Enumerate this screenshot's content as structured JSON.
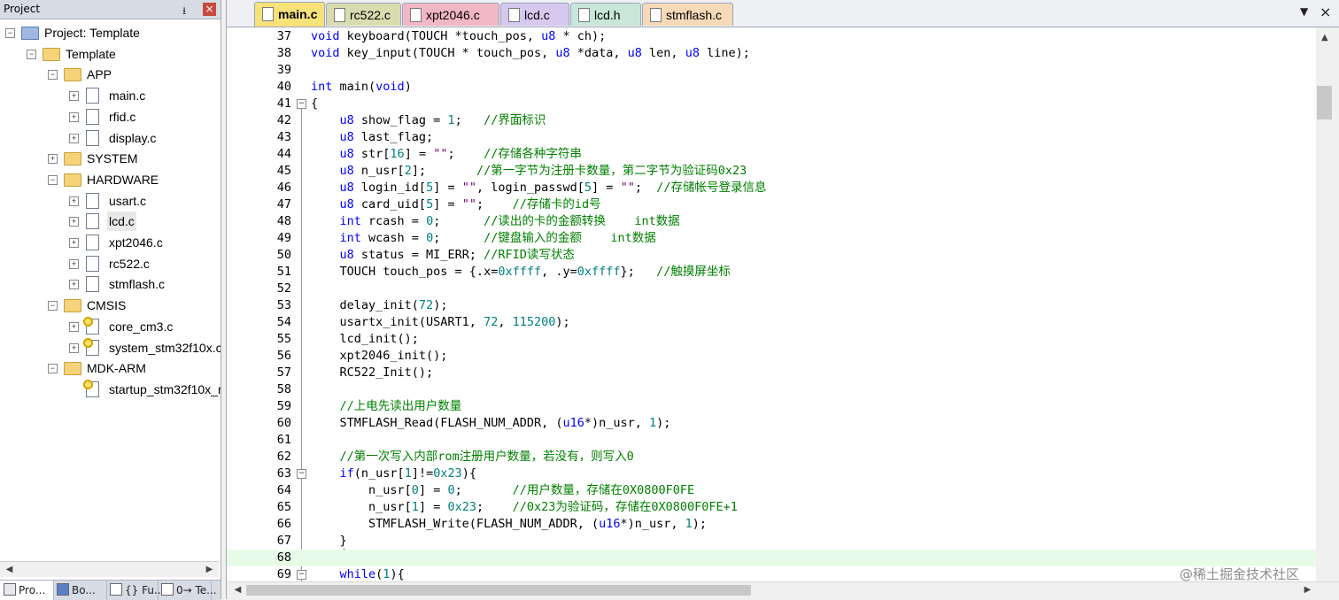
{
  "project_panel": {
    "title": "Project",
    "pin": "⭳",
    "close": "×",
    "tree": [
      {
        "label": "Project: Template",
        "kind": "project",
        "level": 0,
        "expander": "−"
      },
      {
        "label": "Template",
        "kind": "target",
        "level": 1,
        "expander": "−"
      },
      {
        "label": "APP",
        "kind": "folder",
        "level": 2,
        "expander": "−"
      },
      {
        "label": "main.c",
        "kind": "file",
        "level": 3,
        "expander": "+"
      },
      {
        "label": "rfid.c",
        "kind": "file",
        "level": 3,
        "expander": "+"
      },
      {
        "label": "display.c",
        "kind": "file",
        "level": 3,
        "expander": "+"
      },
      {
        "label": "SYSTEM",
        "kind": "folder",
        "level": 2,
        "expander": "+"
      },
      {
        "label": "HARDWARE",
        "kind": "folder",
        "level": 2,
        "expander": "−"
      },
      {
        "label": "usart.c",
        "kind": "file",
        "level": 3,
        "expander": "+"
      },
      {
        "label": "lcd.c",
        "kind": "file",
        "level": 3,
        "expander": "+",
        "selected": true
      },
      {
        "label": "xpt2046.c",
        "kind": "file",
        "level": 3,
        "expander": "+"
      },
      {
        "label": "rc522.c",
        "kind": "file",
        "level": 3,
        "expander": "+"
      },
      {
        "label": "stmflash.c",
        "kind": "file",
        "level": 3,
        "expander": "+"
      },
      {
        "label": "CMSIS",
        "kind": "folder",
        "level": 2,
        "expander": "−"
      },
      {
        "label": "core_cm3.c",
        "kind": "keyfile",
        "level": 3,
        "expander": "+"
      },
      {
        "label": "system_stm32f10x.c",
        "kind": "keyfile",
        "level": 3,
        "expander": "+"
      },
      {
        "label": "MDK-ARM",
        "kind": "folder",
        "level": 2,
        "expander": "−"
      },
      {
        "label": "startup_stm32f10x_md.s",
        "kind": "keyfile",
        "level": 3,
        "expander": ""
      }
    ],
    "bottom_tabs": [
      {
        "label": "Pro...",
        "icon": "project-tab-icon",
        "active": true
      },
      {
        "label": "Bo...",
        "icon": "books-tab-icon"
      },
      {
        "label": "{} Fu...",
        "icon": "functions-tab-icon"
      },
      {
        "label": "0→ Te...",
        "icon": "templates-tab-icon"
      }
    ]
  },
  "editor": {
    "tabs": [
      {
        "label": "main.c",
        "color": "#f7e27a",
        "active": true
      },
      {
        "label": "rc522.c",
        "color": "#d8ddb0"
      },
      {
        "label": "xpt2046.c",
        "color": "#f2b7c4"
      },
      {
        "label": "lcd.c",
        "color": "#d6c8ef"
      },
      {
        "label": "lcd.h",
        "color": "#c8e6d9"
      },
      {
        "label": "stmflash.c",
        "color": "#f6d9b8"
      }
    ],
    "dropdown": "▼",
    "close": "×",
    "current_line": 68,
    "lines": [
      {
        "n": "37",
        "fold": "",
        "tokens": [
          [
            "kw",
            "void"
          ],
          [
            "tx",
            " keyboard(TOUCH *touch_pos, "
          ],
          [
            "kw",
            "u8"
          ],
          [
            "tx",
            " * ch);"
          ]
        ]
      },
      {
        "n": "38",
        "fold": "",
        "tokens": [
          [
            "kw",
            "void"
          ],
          [
            "tx",
            " key_input(TOUCH * touch_pos, "
          ],
          [
            "kw",
            "u8"
          ],
          [
            "tx",
            " *data, "
          ],
          [
            "kw",
            "u8"
          ],
          [
            "tx",
            " len, "
          ],
          [
            "kw",
            "u8"
          ],
          [
            "tx",
            " line);"
          ]
        ]
      },
      {
        "n": "39",
        "fold": "",
        "tokens": []
      },
      {
        "n": "40",
        "fold": "",
        "tokens": [
          [
            "kw",
            "int"
          ],
          [
            "tx",
            " main("
          ],
          [
            "kw",
            "void"
          ],
          [
            "tx",
            ")"
          ]
        ]
      },
      {
        "n": "41",
        "fold": "box",
        "tokens": [
          [
            "tx",
            "{"
          ]
        ]
      },
      {
        "n": "42",
        "fold": "",
        "tokens": [
          [
            "tx",
            "    "
          ],
          [
            "kw",
            "u8"
          ],
          [
            "tx",
            " show_flag = "
          ],
          [
            "num",
            "1"
          ],
          [
            "tx",
            ";   "
          ],
          [
            "cm",
            "//界面标识"
          ]
        ]
      },
      {
        "n": "43",
        "fold": "",
        "tokens": [
          [
            "tx",
            "    "
          ],
          [
            "kw",
            "u8"
          ],
          [
            "tx",
            " last_flag;"
          ]
        ]
      },
      {
        "n": "44",
        "fold": "",
        "tokens": [
          [
            "tx",
            "    "
          ],
          [
            "kw",
            "u8"
          ],
          [
            "tx",
            " str["
          ],
          [
            "num",
            "16"
          ],
          [
            "tx",
            "] = "
          ],
          [
            "str",
            "\"\""
          ],
          [
            "tx",
            ";    "
          ],
          [
            "cm",
            "//存储各种字符串"
          ]
        ]
      },
      {
        "n": "45",
        "fold": "",
        "tokens": [
          [
            "tx",
            "    "
          ],
          [
            "kw",
            "u8"
          ],
          [
            "tx",
            " n_usr["
          ],
          [
            "num",
            "2"
          ],
          [
            "tx",
            "];       "
          ],
          [
            "cm",
            "//第一字节为注册卡数量，第二字节为验证码0x23"
          ]
        ]
      },
      {
        "n": "46",
        "fold": "",
        "tokens": [
          [
            "tx",
            "    "
          ],
          [
            "kw",
            "u8"
          ],
          [
            "tx",
            " login_id["
          ],
          [
            "num",
            "5"
          ],
          [
            "tx",
            "] = "
          ],
          [
            "str",
            "\"\""
          ],
          [
            "tx",
            ", login_passwd["
          ],
          [
            "num",
            "5"
          ],
          [
            "tx",
            "] = "
          ],
          [
            "str",
            "\"\""
          ],
          [
            "tx",
            ";  "
          ],
          [
            "cm",
            "//存储帐号登录信息"
          ]
        ]
      },
      {
        "n": "47",
        "fold": "",
        "tokens": [
          [
            "tx",
            "    "
          ],
          [
            "kw",
            "u8"
          ],
          [
            "tx",
            " card_uid["
          ],
          [
            "num",
            "5"
          ],
          [
            "tx",
            "] = "
          ],
          [
            "str",
            "\"\""
          ],
          [
            "tx",
            ";    "
          ],
          [
            "cm",
            "//存储卡的id号"
          ]
        ]
      },
      {
        "n": "48",
        "fold": "",
        "tokens": [
          [
            "tx",
            "    "
          ],
          [
            "kw",
            "int"
          ],
          [
            "tx",
            " rcash = "
          ],
          [
            "num",
            "0"
          ],
          [
            "tx",
            ";      "
          ],
          [
            "cm",
            "//读出的卡的金额转换    int数据"
          ]
        ]
      },
      {
        "n": "49",
        "fold": "",
        "tokens": [
          [
            "tx",
            "    "
          ],
          [
            "kw",
            "int"
          ],
          [
            "tx",
            " wcash = "
          ],
          [
            "num",
            "0"
          ],
          [
            "tx",
            ";      "
          ],
          [
            "cm",
            "//键盘输入的金额    int数据"
          ]
        ]
      },
      {
        "n": "50",
        "fold": "",
        "tokens": [
          [
            "tx",
            "    "
          ],
          [
            "kw",
            "u8"
          ],
          [
            "tx",
            " status = MI_ERR; "
          ],
          [
            "cm",
            "//RFID读写状态"
          ]
        ]
      },
      {
        "n": "51",
        "fold": "",
        "tokens": [
          [
            "tx",
            "    TOUCH touch_pos = {.x="
          ],
          [
            "num",
            "0xffff"
          ],
          [
            "tx",
            ", .y="
          ],
          [
            "num",
            "0xffff"
          ],
          [
            "tx",
            "};   "
          ],
          [
            "cm",
            "//触摸屏坐标"
          ]
        ]
      },
      {
        "n": "52",
        "fold": "",
        "tokens": []
      },
      {
        "n": "53",
        "fold": "",
        "tokens": [
          [
            "tx",
            "    delay_init("
          ],
          [
            "num",
            "72"
          ],
          [
            "tx",
            ");"
          ]
        ]
      },
      {
        "n": "54",
        "fold": "",
        "tokens": [
          [
            "tx",
            "    usartx_init(USART1, "
          ],
          [
            "num",
            "72"
          ],
          [
            "tx",
            ", "
          ],
          [
            "num",
            "115200"
          ],
          [
            "tx",
            ");"
          ]
        ]
      },
      {
        "n": "55",
        "fold": "",
        "tokens": [
          [
            "tx",
            "    lcd_init();"
          ]
        ]
      },
      {
        "n": "56",
        "fold": "",
        "tokens": [
          [
            "tx",
            "    xpt2046_init();"
          ]
        ]
      },
      {
        "n": "57",
        "fold": "",
        "tokens": [
          [
            "tx",
            "    RC522_Init();"
          ]
        ]
      },
      {
        "n": "58",
        "fold": "",
        "tokens": []
      },
      {
        "n": "59",
        "fold": "",
        "tokens": [
          [
            "tx",
            "    "
          ],
          [
            "cm",
            "//上电先读出用户数量"
          ]
        ]
      },
      {
        "n": "60",
        "fold": "",
        "tokens": [
          [
            "tx",
            "    STMFLASH_Read(FLASH_NUM_ADDR, ("
          ],
          [
            "kw",
            "u16"
          ],
          [
            "tx",
            "*)n_usr, "
          ],
          [
            "num",
            "1"
          ],
          [
            "tx",
            ");"
          ]
        ]
      },
      {
        "n": "61",
        "fold": "",
        "tokens": []
      },
      {
        "n": "62",
        "fold": "",
        "tokens": [
          [
            "tx",
            "    "
          ],
          [
            "cm",
            "//第一次写入内部rom注册用户数量，若没有，则写入0"
          ]
        ]
      },
      {
        "n": "63",
        "fold": "box",
        "tokens": [
          [
            "tx",
            "    "
          ],
          [
            "kw",
            "if"
          ],
          [
            "tx",
            "(n_usr["
          ],
          [
            "num",
            "1"
          ],
          [
            "tx",
            "]!="
          ],
          [
            "num",
            "0x23"
          ],
          [
            "tx",
            "){"
          ]
        ]
      },
      {
        "n": "64",
        "fold": "",
        "tokens": [
          [
            "tx",
            "        n_usr["
          ],
          [
            "num",
            "0"
          ],
          [
            "tx",
            "] = "
          ],
          [
            "num",
            "0"
          ],
          [
            "tx",
            ";       "
          ],
          [
            "cm",
            "//用户数量，存储在0X0800F0FE"
          ]
        ]
      },
      {
        "n": "65",
        "fold": "",
        "tokens": [
          [
            "tx",
            "        n_usr["
          ],
          [
            "num",
            "1"
          ],
          [
            "tx",
            "] = "
          ],
          [
            "num",
            "0x23"
          ],
          [
            "tx",
            ";    "
          ],
          [
            "cm",
            "//0x23为验证码，存储在0X0800F0FE+1"
          ]
        ]
      },
      {
        "n": "66",
        "fold": "",
        "tokens": [
          [
            "tx",
            "        STMFLASH_Write(FLASH_NUM_ADDR, ("
          ],
          [
            "kw",
            "u16"
          ],
          [
            "tx",
            "*)n_usr, "
          ],
          [
            "num",
            "1"
          ],
          [
            "tx",
            ");"
          ]
        ]
      },
      {
        "n": "67",
        "fold": "",
        "tokens": [
          [
            "tx",
            "    }"
          ]
        ]
      },
      {
        "n": "68",
        "fold": "",
        "tokens": []
      },
      {
        "n": "69",
        "fold": "box",
        "tokens": [
          [
            "tx",
            "    "
          ],
          [
            "kw",
            "while"
          ],
          [
            "tx",
            "("
          ],
          [
            "num",
            "1"
          ],
          [
            "tx",
            "){"
          ]
        ]
      }
    ]
  },
  "watermark": "@稀土掘金技术社区"
}
